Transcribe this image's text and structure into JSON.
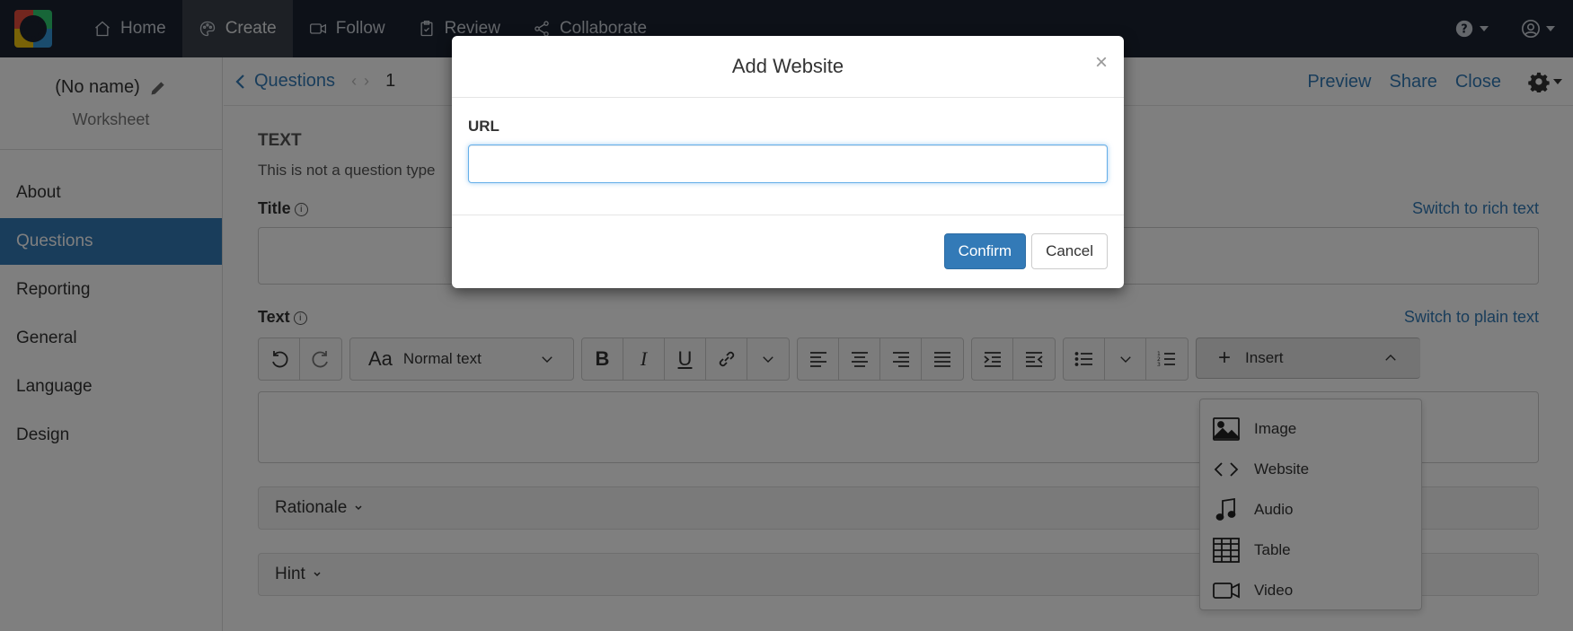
{
  "nav": {
    "items": [
      {
        "label": "Home",
        "icon": "home-icon"
      },
      {
        "label": "Create",
        "icon": "palette-icon",
        "active": true
      },
      {
        "label": "Follow",
        "icon": "video-icon"
      },
      {
        "label": "Review",
        "icon": "clipboard-icon"
      },
      {
        "label": "Collaborate",
        "icon": "share-icon"
      }
    ]
  },
  "sidebar": {
    "project_name": "(No name)",
    "project_type": "Worksheet",
    "items": [
      {
        "label": "About"
      },
      {
        "label": "Questions",
        "active": true
      },
      {
        "label": "Reporting"
      },
      {
        "label": "General"
      },
      {
        "label": "Language"
      },
      {
        "label": "Design"
      }
    ]
  },
  "subbar": {
    "back_label": "Questions",
    "question_number": "1",
    "preview": "Preview",
    "share": "Share",
    "close": "Close"
  },
  "content": {
    "section_heading": "TEXT",
    "section_desc": "This is not a question type",
    "title_label": "Title",
    "title_switch": "Switch to rich text",
    "text_label": "Text",
    "text_switch": "Switch to plain text",
    "format_label": "Normal text",
    "insert_label": "Insert",
    "rationale": "Rationale",
    "hint": "Hint"
  },
  "insert_menu": {
    "items": [
      {
        "label": "Image"
      },
      {
        "label": "Website"
      },
      {
        "label": "Audio"
      },
      {
        "label": "Table"
      },
      {
        "label": "Video"
      }
    ]
  },
  "modal": {
    "title": "Add Website",
    "close_symbol": "×",
    "url_label": "URL",
    "url_value": "",
    "confirm": "Confirm",
    "cancel": "Cancel"
  },
  "colors": {
    "nav_bg": "#1b2230",
    "primary": "#337ab7",
    "active_side": "#337ab7"
  }
}
